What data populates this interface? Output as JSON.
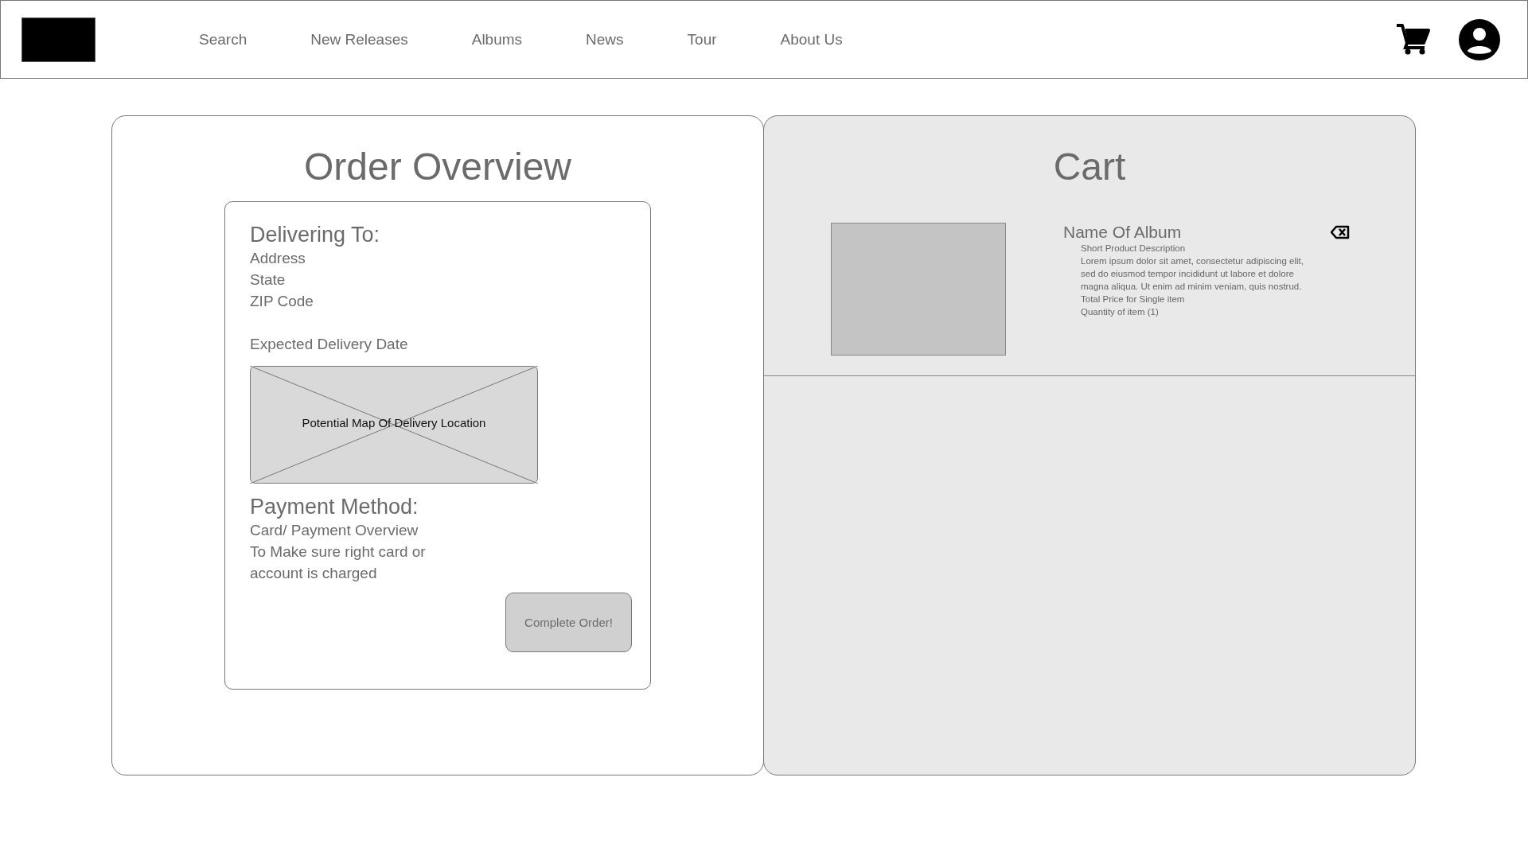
{
  "header": {
    "nav": [
      "Search",
      "New Releases",
      "Albums",
      "News",
      "Tour",
      "About Us"
    ]
  },
  "order_overview": {
    "title": "Order Overview",
    "delivering_heading": "Delivering To:",
    "address_lines": [
      "Address",
      "State",
      "ZIP Code"
    ],
    "expected_delivery": "Expected Delivery Date",
    "map_label": "Potential Map Of Delivery Location",
    "payment_heading": "Payment Method:",
    "payment_text": [
      "Card/ Payment Overview",
      "To Make sure right card or",
      "account is charged"
    ],
    "button": "Complete Order!"
  },
  "cart": {
    "title": "Cart",
    "items": [
      {
        "name": "Name Of Album",
        "description_title": "Short Product Description",
        "description": "Lorem ipsum dolor sit amet, consectetur adipiscing elit, sed do eiusmod tempor incididunt ut labore et dolore magna aliqua. Ut enim ad minim veniam, quis nostrud.",
        "price": "Total Price for Single item",
        "quantity": "Quantity of item (1)"
      }
    ]
  }
}
